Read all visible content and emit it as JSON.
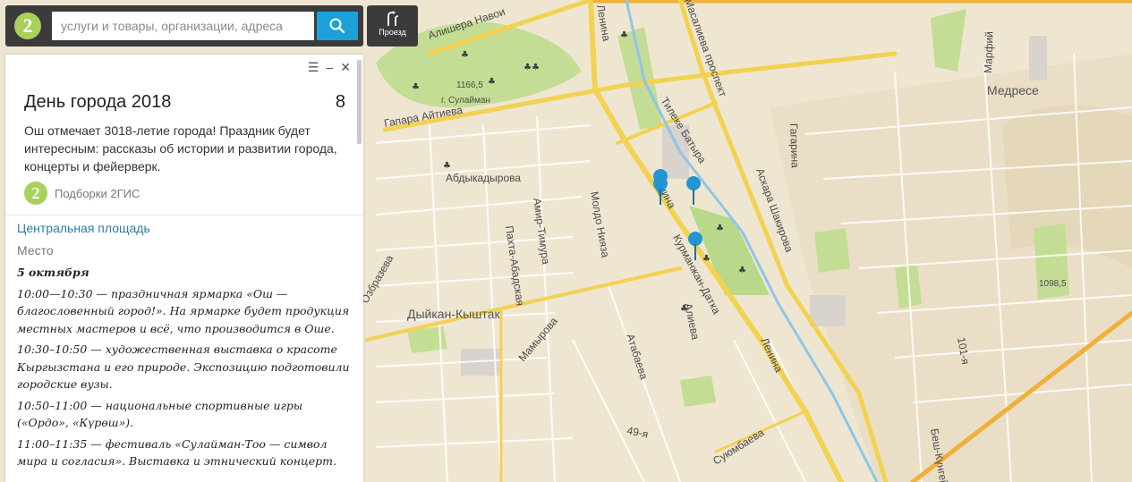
{
  "search": {
    "placeholder": "услуги и товары, организации, адреса",
    "logo_text": "2",
    "route_label": "Проезд"
  },
  "panel": {
    "title": "День города 2018",
    "count": "8",
    "description": "Ош отмечает 3018-летие города! Праздник будет интересным: рассказы об истории и развитии города, концерты и фейерверк.",
    "source_logo": "2",
    "source": "Подборки 2ГИС",
    "place_name": "Центральная площадь",
    "place_type": "Место",
    "schedule_date": "5 октября",
    "schedule": [
      "10:00—10:30 — праздничная ярмарка «Ош — благословенный город!». На ярмарке будет продукция местных мастеров и всё, что производится в Оше.",
      "10:30–10:50 — художественная выставка о красоте Кыргызстана и его природе. Экспозицию подготовили городские вузы.",
      "10:50–11:00 — национальные спортивные игры («Ордо», «Күрөш»).",
      "11:00–11:35 — фестиваль «Сулайман-Тоо — символ мира и согласия». Выставка и этнический концерт."
    ]
  },
  "map": {
    "labels": {
      "alishera_navoi": "Алишера Навои",
      "lenina_top": "Ленина",
      "prospekt": "Масалиева проспект",
      "marfiy": "Марфий",
      "medrese": "Медресе",
      "height_1166": "1166,5",
      "sulayman": "г. Сулайман",
      "gapara": "Гапара Айтиева",
      "tileke": "Тилеке Батыра",
      "gagarina": "Гагарина",
      "abdykadyrova": "Абдыкадырова",
      "lenina_mid": "Ленина",
      "askara": "Аскара Шакирова",
      "moldo": "Молдо Нияза",
      "amir": "Амир-Тимура",
      "pakhta": "Пахта-Абадская",
      "kurmanjan": "Курманжан-Датка",
      "alieva": "Алиева",
      "dyikan": "Дыйкан-Кыштак",
      "mamyrova": "Мамырова",
      "atabaeva": "Атабаева",
      "lenina_bottom": "Ленина",
      "height_1098": "1098,5",
      "s101": "101-я",
      "s49": "49-я",
      "suyumbaeva": "Суюмбаева",
      "besh": "Беш-Күнгей",
      "ozbrazeva": "Озбразева"
    }
  },
  "colors": {
    "accent": "#1ba1d8",
    "brand": "#a8d05a",
    "marker": "#2196d3",
    "link": "#2a7fa8",
    "road_major": "#f2d250",
    "park": "#b9d98a"
  }
}
